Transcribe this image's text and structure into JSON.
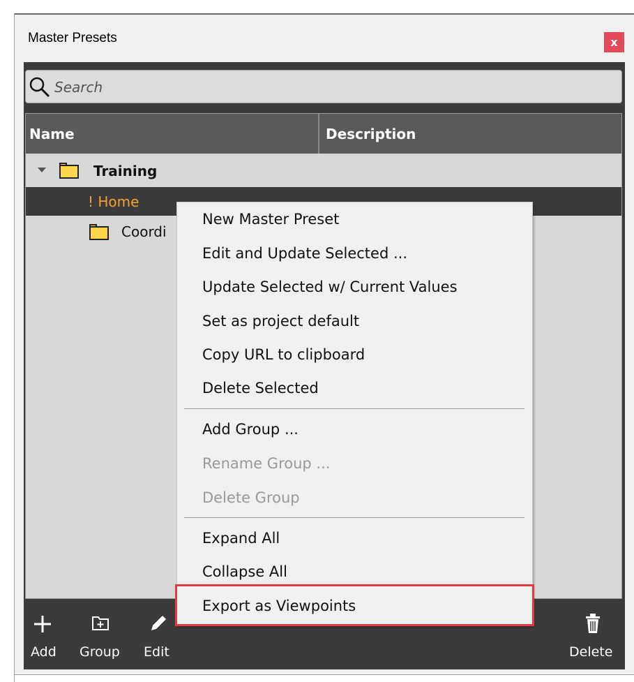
{
  "window": {
    "title": "Master Presets",
    "close_label": "x"
  },
  "search": {
    "placeholder": "Search"
  },
  "table": {
    "columns": [
      "Name",
      "Description"
    ],
    "rows": [
      {
        "label": "Training",
        "type": "group"
      },
      {
        "label": "! Home",
        "type": "preset",
        "selected": true
      },
      {
        "label": "Coordi",
        "type": "group"
      }
    ]
  },
  "context_menu": {
    "items": [
      {
        "label": "New Master Preset",
        "enabled": true
      },
      {
        "label": "Edit and Update Selected ...",
        "enabled": true
      },
      {
        "label": "Update Selected w/ Current Values",
        "enabled": true
      },
      {
        "label": "Set as project default",
        "enabled": true
      },
      {
        "label": "Copy URL to clipboard",
        "enabled": true
      },
      {
        "label": "Delete Selected",
        "enabled": true
      },
      {
        "label": "Add Group ...",
        "enabled": true
      },
      {
        "label": "Rename Group ...",
        "enabled": false
      },
      {
        "label": "Delete Group",
        "enabled": false
      },
      {
        "label": "Expand All",
        "enabled": true
      },
      {
        "label": "Collapse All",
        "enabled": true
      },
      {
        "label": "Export as Viewpoints",
        "enabled": true,
        "highlighted": true
      }
    ]
  },
  "toolbar": {
    "add_label": "Add",
    "group_label": "Group",
    "edit_label": "Edit",
    "delete_label": "Delete"
  },
  "colors": {
    "close_button": "#e24a5a",
    "selected_text": "#f0a030",
    "highlight_border": "#e53945",
    "folder": "#ffd54a"
  },
  "icons": [
    "search-icon",
    "folder-icon",
    "expand-arrow-icon",
    "plus-icon",
    "folder-add-icon",
    "pencil-icon",
    "trash-icon"
  ]
}
